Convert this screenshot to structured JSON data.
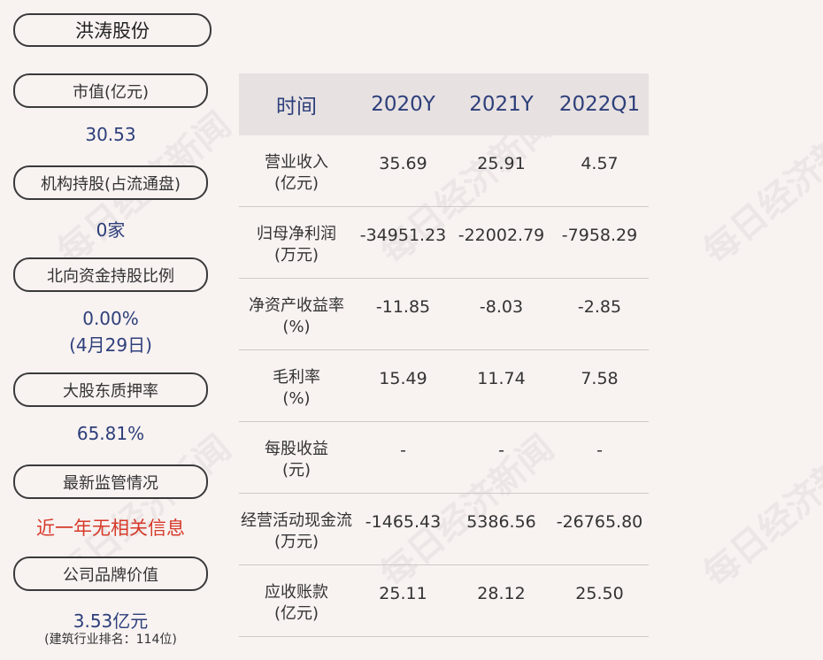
{
  "company": "洪涛股份",
  "left_panel": [
    {
      "label": "市值(亿元)",
      "value": "30.53"
    },
    {
      "label": "机构持股(占流通盘)",
      "value": "0家"
    },
    {
      "label": "北向资金持股比例",
      "value": "0.00%",
      "value2": "(4月29日)"
    },
    {
      "label": "大股东质押率",
      "value": "65.81%"
    },
    {
      "label": "最新监管情况",
      "value": "近一年无相关信息"
    },
    {
      "label": "公司品牌价值",
      "value": "3.53亿元",
      "note": "(建筑行业排名：114位)"
    }
  ],
  "table": {
    "headers": [
      "时间",
      "2020Y",
      "2021Y",
      "2022Q1"
    ],
    "rows": [
      {
        "label": "营业收入",
        "unit": "(亿元)",
        "values": [
          "35.69",
          "25.91",
          "4.57"
        ]
      },
      {
        "label": "归母净利润",
        "unit": "(万元)",
        "values": [
          "-34951.23",
          "-22002.79",
          "-7958.29"
        ]
      },
      {
        "label": "净资产收益率",
        "unit": "(%)",
        "values": [
          "-11.85",
          "-8.03",
          "-2.85"
        ]
      },
      {
        "label": "毛利率",
        "unit": "(%)",
        "values": [
          "15.49",
          "11.74",
          "7.58"
        ]
      },
      {
        "label": "每股收益",
        "unit": "(元)",
        "values": [
          "-",
          "-",
          "-"
        ]
      },
      {
        "label": "经营活动现金流",
        "unit": "(万元)",
        "values": [
          "-1465.43",
          "5386.56",
          "-26765.80"
        ]
      },
      {
        "label": "应收账款",
        "unit": "(亿元)",
        "values": [
          "25.11",
          "28.12",
          "25.50"
        ]
      }
    ]
  },
  "watermark": "每日经济新闻",
  "colors": {
    "background": "#f8f2f1",
    "value_blue": "#2d3f7a",
    "alert_red": "#d63a2a",
    "header_bg": "#e7e1e1"
  }
}
